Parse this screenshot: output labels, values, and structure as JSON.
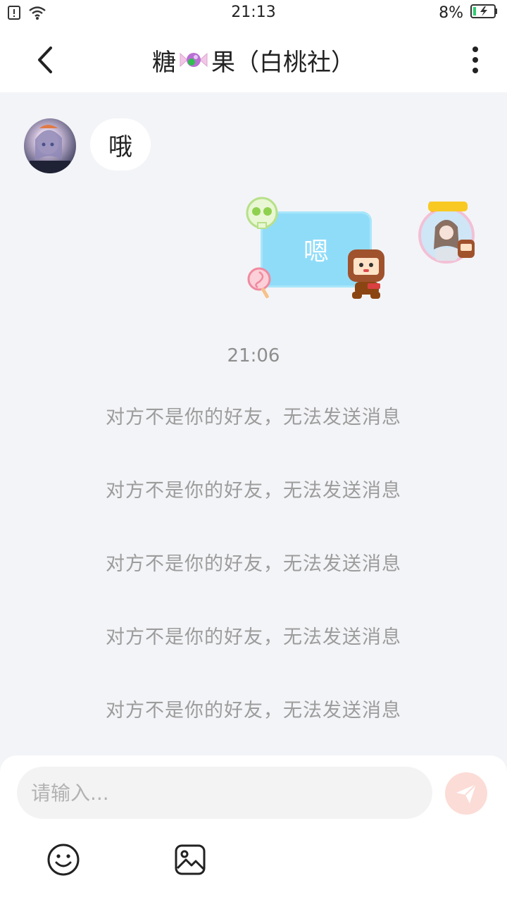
{
  "status_bar": {
    "time": "21:13",
    "battery_percent": "8%",
    "icons": [
      "sim-alert-icon",
      "wifi-icon",
      "battery-charging-icon"
    ]
  },
  "header": {
    "title_prefix": "糖",
    "title_suffix": "果（白桃社）",
    "icons": [
      "back-arrow-icon",
      "candy-emoji-icon",
      "more-vertical-icon"
    ]
  },
  "messages": [
    {
      "side": "left",
      "text": "哦"
    },
    {
      "side": "right",
      "text": "嗯"
    }
  ],
  "timestamp": "21:06",
  "system_messages": [
    "对方不是你的好友，无法发送消息",
    "对方不是你的好友，无法发送消息",
    "对方不是你的好友，无法发送消息",
    "对方不是你的好友，无法发送消息",
    "对方不是你的好友，无法发送消息"
  ],
  "composer": {
    "placeholder": "请输入...",
    "value": "",
    "icons": [
      "send-icon",
      "emoji-icon",
      "image-icon"
    ]
  },
  "colors": {
    "background": "#f3f4f7",
    "bubble_right": "#8fdcf9",
    "send_button": "#fcdcd6",
    "system_text": "#9c9c9c"
  }
}
